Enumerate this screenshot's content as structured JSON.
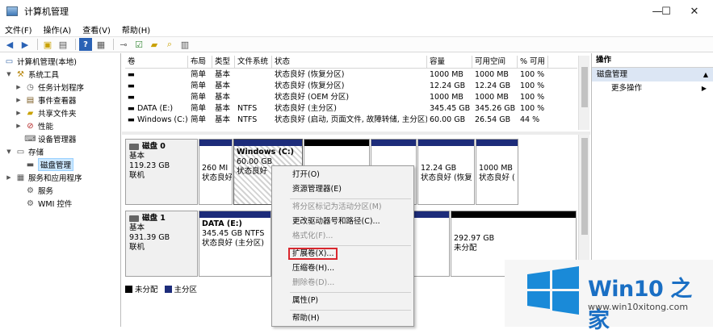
{
  "window": {
    "title": "计算机管理",
    "controls": {
      "minimize": "—",
      "maximize": "☐",
      "close": "✕"
    }
  },
  "menu": [
    "文件(F)",
    "操作(A)",
    "查看(V)",
    "帮助(H)"
  ],
  "tree": {
    "root": "计算机管理(本地)",
    "system_tools": "系统工具",
    "task_scheduler": "任务计划程序",
    "event_viewer": "事件查看器",
    "shared_folders": "共享文件夹",
    "performance": "性能",
    "device_manager": "设备管理器",
    "storage": "存储",
    "disk_management": "磁盘管理",
    "services_apps": "服务和应用程序",
    "services": "服务",
    "wmi": "WMI 控件"
  },
  "volume_table": {
    "columns": [
      "卷",
      "布局",
      "类型",
      "文件系统",
      "状态",
      "容量",
      "可用空间",
      "% 可用"
    ],
    "rows": [
      [
        "",
        "简单",
        "基本",
        "",
        "状态良好 (恢复分区)",
        "1000 MB",
        "1000 MB",
        "100 %"
      ],
      [
        "",
        "简单",
        "基本",
        "",
        "状态良好 (恢复分区)",
        "12.24 GB",
        "12.24 GB",
        "100 %"
      ],
      [
        "",
        "简单",
        "基本",
        "",
        "状态良好 (OEM 分区)",
        "1000 MB",
        "1000 MB",
        "100 %"
      ],
      [
        "DATA (E:)",
        "简单",
        "基本",
        "NTFS",
        "状态良好 (主分区)",
        "345.45 GB",
        "345.26 GB",
        "100 %"
      ],
      [
        "Windows (C:)",
        "简单",
        "基本",
        "NTFS",
        "状态良好 (启动, 页面文件, 故障转储, 主分区)",
        "60.00 GB",
        "26.54 GB",
        "44 %"
      ]
    ]
  },
  "disks": [
    {
      "name": "磁盘 0",
      "type": "基本",
      "size": "119.23 GB",
      "status": "联机",
      "partitions": [
        {
          "line1": "260 MI",
          "line2": "状态良好",
          "bar": "#1d2c7a"
        },
        {
          "title": "Windows  (C:)",
          "line1": "60.00 GB",
          "line2": "状态良好",
          "bar": "#1d2c7a",
          "hatched": true
        },
        {
          "line1": "",
          "line2": "",
          "bar": "#000000"
        },
        {
          "line1": "",
          "line2": "",
          "bar": "#1d2c7a"
        },
        {
          "line1": "12.24 GB",
          "line2": "状态良好 (恢复",
          "bar": "#1d2c7a"
        },
        {
          "line1": "1000 MB",
          "line2": "状态良好 (",
          "bar": "#1d2c7a"
        }
      ]
    },
    {
      "name": "磁盘 1",
      "type": "基本",
      "size": "931.39 GB",
      "status": "联机",
      "partitions": [
        {
          "title": "DATA  (E:)",
          "line1": "345.45 GB NTFS",
          "line2": "状态良好 (主分区)",
          "bar": "#1d2c7a"
        },
        {
          "line1": "",
          "line2": "",
          "bar": "#1d2c7a"
        },
        {
          "line1": "292.97 GB",
          "line2": "未分配",
          "bar": "#000000"
        }
      ]
    }
  ],
  "legend": {
    "unallocated": "未分配",
    "primary": "主分区",
    "unallocated_color": "#000000",
    "primary_color": "#1d2c7a"
  },
  "context_menu": {
    "open": "打开(O)",
    "explorer": "资源管理器(E)",
    "mark_active": "将分区标记为活动分区(M)",
    "change_letter": "更改驱动器号和路径(C)...",
    "format": "格式化(F)...",
    "extend": "扩展卷(X)...",
    "shrink": "压缩卷(H)...",
    "delete": "删除卷(D)...",
    "properties": "属性(P)",
    "help": "帮助(H)"
  },
  "actions": {
    "header": "操作",
    "group": "磁盘管理",
    "more": "更多操作"
  },
  "watermark": {
    "brand": "Win10 之家",
    "url": "www.win10xitong.com"
  },
  "colors": {
    "accent": "#1a6fc4",
    "selection": "#cce8ff",
    "highlight_box": "#d9272e"
  }
}
